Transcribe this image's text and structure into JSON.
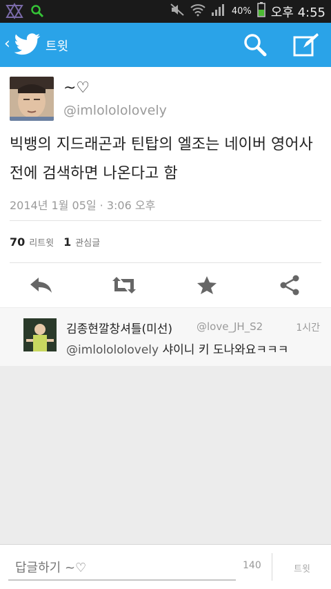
{
  "status_bar": {
    "battery_percent": "40%",
    "time": "오후 4:55"
  },
  "top_bar": {
    "title": "트윗"
  },
  "tweet": {
    "display_name": "~♡",
    "handle": "@imlolololovely",
    "text": "빅뱅의 지드래곤과 틴탑의 엘조는 네이버 영어사전에 검색하면 나온다고 함",
    "date": "2014년 1월 05일 · 3:06 오후",
    "retweets_count": "70",
    "retweets_label": "리트윗",
    "favorites_count": "1",
    "favorites_label": "관심글"
  },
  "reply": {
    "display_name": "김종현깔창셔틀(미선)",
    "handle": "@love_JH_S2",
    "time": "1시간",
    "mention": "@imlolololovely",
    "text": "샤이니 키 도나와요ㅋㅋㅋ"
  },
  "compose": {
    "placeholder": "답글하기 ~♡",
    "char_count": "140",
    "send_label": "트윗"
  },
  "colors": {
    "accent": "#2aa3e8",
    "statusbar": "#1a1a1a"
  }
}
